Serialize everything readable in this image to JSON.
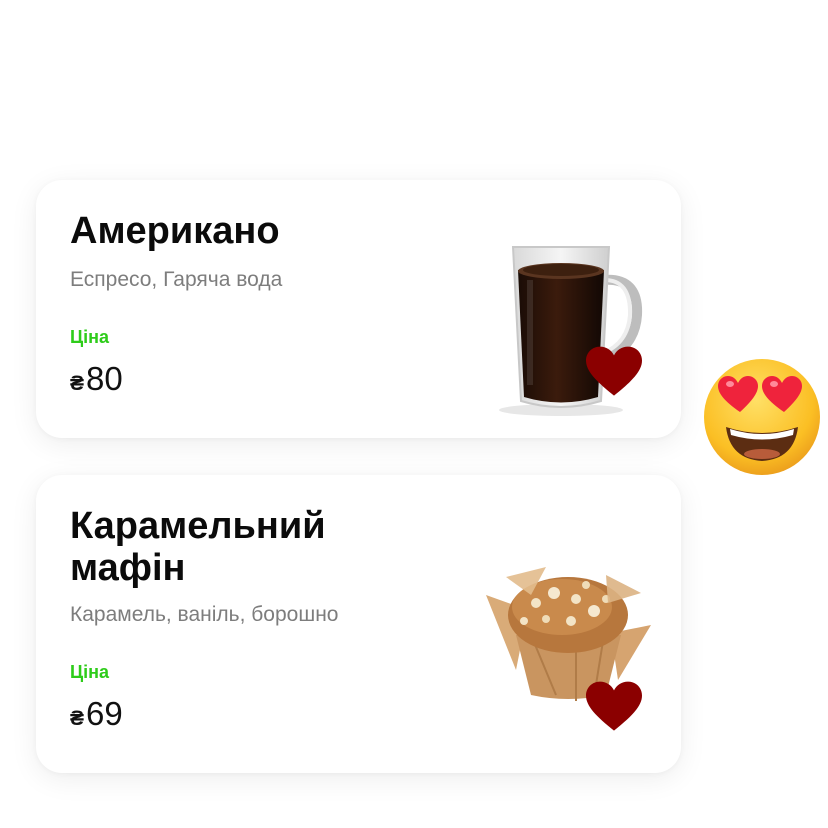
{
  "products": [
    {
      "name": "Американо",
      "description": "Еспресо, Гаряча вода",
      "price_label": "Ціна",
      "currency": "₴",
      "price": "80",
      "image": "coffee-mug",
      "favorite": true
    },
    {
      "name": "Карамельний мафін",
      "description": "Карамель, ваніль, борошно",
      "price_label": "Ціна",
      "currency": "₴",
      "price": "69",
      "image": "caramel-muffin",
      "favorite": true
    }
  ],
  "colors": {
    "price_label": "#2ecc1a",
    "heart": "#8b0000",
    "description": "#7d7d7d"
  },
  "decoration": {
    "emoji": "heart-eyes-emoji"
  }
}
